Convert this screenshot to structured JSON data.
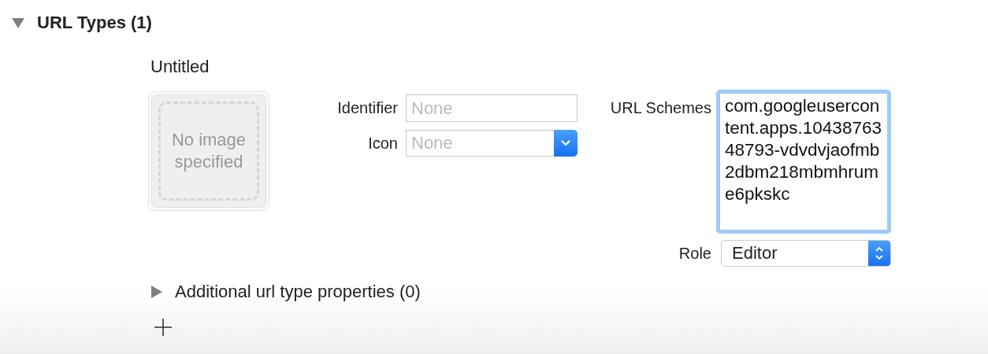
{
  "section": {
    "title": "URL Types (1)",
    "expanded": true
  },
  "url_type": {
    "name": "Untitled",
    "image_placeholder": "No image specified",
    "identifier": {
      "label": "Identifier",
      "placeholder": "None"
    },
    "icon": {
      "label": "Icon",
      "placeholder": "None"
    },
    "url_schemes": {
      "label": "URL Schemes",
      "value": "com.googleusercontent.apps.1043876348793-vdvdvjaofmb2dbm218mbmhrume6pkskc",
      "focused": true
    },
    "role": {
      "label": "Role",
      "value": "Editor"
    }
  },
  "additional": {
    "label": "Additional url type properties (0)",
    "expanded": false
  }
}
